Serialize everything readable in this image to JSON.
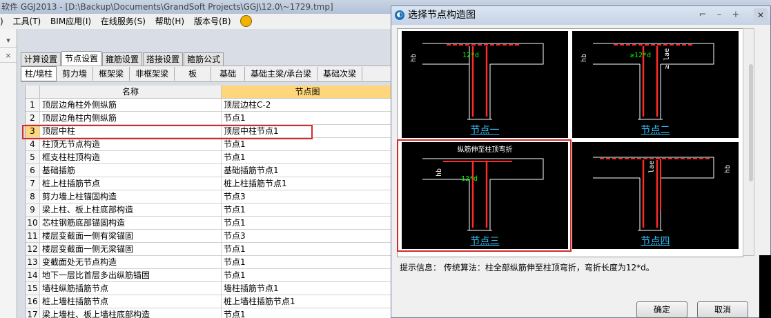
{
  "app_title": "软件 GGJ2013 - [D:\\Backup\\Documents\\GrandSoft Projects\\GGJ\\12.0\\~1729.tmp]",
  "menu": [
    "工具(T)",
    "BIM应用(I)",
    "在线服务(S)",
    "帮助(H)",
    "版本号(B)"
  ],
  "menu_prefix": ")",
  "left_strip": [
    "",
    ""
  ],
  "tabs": [
    "计算设置",
    "节点设置",
    "箍筋设置",
    "搭接设置",
    "箍筋公式"
  ],
  "active_tab": 1,
  "subtabs": [
    "柱/墙柱",
    "剪力墙",
    "框架梁",
    "非框架梁",
    "板",
    "基础",
    "基础主梁/承台梁",
    "基础次梁"
  ],
  "active_subtab": 0,
  "table": {
    "headers": [
      "名称",
      "节点图"
    ],
    "rows": [
      {
        "num": "1",
        "name": "顶层边角柱外侧纵筋",
        "value": "顶层边柱C-2"
      },
      {
        "num": "2",
        "name": "顶层边角柱内侧纵筋",
        "value": "节点1"
      },
      {
        "num": "3",
        "name": "顶层中柱",
        "value": "顶层中柱节点1"
      },
      {
        "num": "4",
        "name": "柱顶无节点构造",
        "value": "节点1"
      },
      {
        "num": "5",
        "name": "框支柱柱顶构造",
        "value": "节点1"
      },
      {
        "num": "6",
        "name": "基础插筋",
        "value": "基础插筋节点1"
      },
      {
        "num": "7",
        "name": "桩上柱插筋节点",
        "value": "桩上柱插筋节点1"
      },
      {
        "num": "8",
        "name": "剪力墙上柱锚固构造",
        "value": "节点3"
      },
      {
        "num": "9",
        "name": "梁上柱、板上柱底部构造",
        "value": "节点1"
      },
      {
        "num": "10",
        "name": "芯柱钢筋底部锚固构造",
        "value": "节点1"
      },
      {
        "num": "11",
        "name": "楼层变截面一侧有梁锚固",
        "value": "节点3"
      },
      {
        "num": "12",
        "name": "楼层变截面一侧无梁锚固",
        "value": "节点1"
      },
      {
        "num": "13",
        "name": "变截面处无节点构造",
        "value": "节点1"
      },
      {
        "num": "14",
        "name": "地下一层比首层多出纵筋锚固",
        "value": "节点1"
      },
      {
        "num": "15",
        "name": "墙柱纵筋插筋节点",
        "value": "墙柱插筋节点1"
      },
      {
        "num": "16",
        "name": "桩上墙柱插筋节点",
        "value": "桩上墙柱插筋节点1"
      },
      {
        "num": "17",
        "name": "梁上墙柱、板上墙柱底部构造",
        "value": "节点1"
      }
    ],
    "selected_row": 2
  },
  "dialog": {
    "title": "选择节点构造图",
    "nodes": [
      {
        "caption": "节点一",
        "dims": [
          "hb",
          "12*d"
        ]
      },
      {
        "caption": "节点二",
        "dims": [
          "hb",
          "≥12*d",
          "≥ lae"
        ]
      },
      {
        "caption": "节点三",
        "subtitle": "纵筋伸至柱顶弯折",
        "dims": [
          "hb",
          "12*d"
        ]
      },
      {
        "caption": "节点四",
        "dims": [
          "lae",
          "hb"
        ]
      }
    ],
    "selected_node": 2,
    "hint": "提示信息： 传统算法：柱全部纵筋伸至柱顶弯折，弯折长度为12*d。",
    "ok": "确定",
    "cancel": "取消"
  },
  "colors": {
    "highlight": "#d42a2a",
    "caption": "#33c3ff",
    "rebar": "#ff2a2a",
    "dim_text": "#00ff00"
  }
}
